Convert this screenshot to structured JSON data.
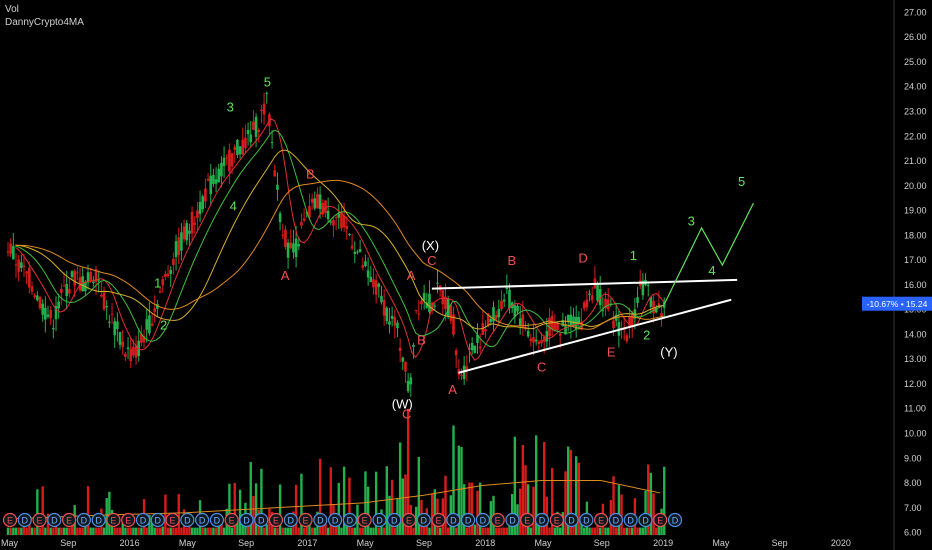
{
  "header": {
    "line1": "Vol",
    "line2": "DannyCrypto4MA"
  },
  "price_badge": {
    "text": "-10.67% • 15.24",
    "color": "#2962ff"
  },
  "colors": {
    "bull": "#22b14c",
    "bear": "#d81b1b",
    "ma_red": "#e03030",
    "ma_green": "#3cbf3c",
    "ma_orange": "#e08a1e",
    "ma_yellow": "#d6b02a",
    "ma_purple": "#b23bd6",
    "wave_green": "#5ee35e",
    "wave_red": "#f05050",
    "wave_white": "#ffffff",
    "trendline": "#ffffff"
  },
  "chart_data": {
    "type": "candlestick",
    "y_axis": {
      "min": 5.7,
      "max": 27.3,
      "ticks": [
        "27.00",
        "26.00",
        "25.00",
        "24.00",
        "23.00",
        "22.00",
        "21.00",
        "20.00",
        "19.00",
        "18.00",
        "17.00",
        "16.00",
        "15.00",
        "14.00",
        "13.00",
        "12.00",
        "11.00",
        "10.00",
        "9.00",
        "8.00",
        "7.00",
        "6.00"
      ]
    },
    "x_axis": {
      "range": [
        0,
        49.5
      ],
      "ticks": [
        {
          "t": 0.0,
          "label": "May"
        },
        {
          "t": 4.0,
          "label": "Sep"
        },
        {
          "t": 8.0,
          "label": "2016"
        },
        {
          "t": 12.0,
          "label": "May"
        },
        {
          "t": 16.0,
          "label": "Sep"
        },
        {
          "t": 20.0,
          "label": "2017"
        },
        {
          "t": 24.0,
          "label": "May"
        },
        {
          "t": 28.0,
          "label": "Sep"
        },
        {
          "t": 32.0,
          "label": "2018"
        },
        {
          "t": 36.0,
          "label": "May"
        },
        {
          "t": 40.0,
          "label": "Sep"
        },
        {
          "t": 44.0,
          "label": "2019"
        },
        {
          "t": 48.0,
          "label": "May"
        },
        {
          "t": 52.0,
          "label": "Sep"
        },
        {
          "t": 56.0,
          "label": "2020"
        }
      ]
    },
    "price_path": [
      [
        0.0,
        17.6
      ],
      [
        0.8,
        16.7
      ],
      [
        1.5,
        16.2
      ],
      [
        2.2,
        15.3
      ],
      [
        3.0,
        14.5
      ],
      [
        3.8,
        15.8
      ],
      [
        4.5,
        16.3
      ],
      [
        5.2,
        16.0
      ],
      [
        6.0,
        16.6
      ],
      [
        6.6,
        15.1
      ],
      [
        7.3,
        14.2
      ],
      [
        8.0,
        13.3
      ],
      [
        8.6,
        13.2
      ],
      [
        9.5,
        14.4
      ],
      [
        10.2,
        15.6
      ],
      [
        11.0,
        16.9
      ],
      [
        11.8,
        17.9
      ],
      [
        12.5,
        18.6
      ],
      [
        13.3,
        19.7
      ],
      [
        14.0,
        20.3
      ],
      [
        14.8,
        20.9
      ],
      [
        15.5,
        21.5
      ],
      [
        16.4,
        22.0
      ],
      [
        17.0,
        22.7
      ],
      [
        17.5,
        23.4
      ],
      [
        17.9,
        21.3
      ],
      [
        18.3,
        19.1
      ],
      [
        18.8,
        17.6
      ],
      [
        19.3,
        17.3
      ],
      [
        19.8,
        18.2
      ],
      [
        20.4,
        19.0
      ],
      [
        21.0,
        19.4
      ],
      [
        21.7,
        18.9
      ],
      [
        22.4,
        18.6
      ],
      [
        23.2,
        17.9
      ],
      [
        23.8,
        17.0
      ],
      [
        24.4,
        16.2
      ],
      [
        25.0,
        15.7
      ],
      [
        25.6,
        14.9
      ],
      [
        26.2,
        14.2
      ],
      [
        26.6,
        13.4
      ],
      [
        27.1,
        11.5
      ],
      [
        27.5,
        15.0
      ],
      [
        28.0,
        15.6
      ],
      [
        28.6,
        15.2
      ],
      [
        29.0,
        15.7
      ],
      [
        29.5,
        15.4
      ],
      [
        30.0,
        14.8
      ],
      [
        30.4,
        12.4
      ],
      [
        30.8,
        12.6
      ],
      [
        31.2,
        13.4
      ],
      [
        31.8,
        13.8
      ],
      [
        32.4,
        14.5
      ],
      [
        33.0,
        14.9
      ],
      [
        33.6,
        15.6
      ],
      [
        34.0,
        15.2
      ],
      [
        34.7,
        14.6
      ],
      [
        35.2,
        14.0
      ],
      [
        35.8,
        13.6
      ],
      [
        36.3,
        14.0
      ],
      [
        36.8,
        14.5
      ],
      [
        37.4,
        14.1
      ],
      [
        38.0,
        14.7
      ],
      [
        38.6,
        14.4
      ],
      [
        39.1,
        15.5
      ],
      [
        39.6,
        16.0
      ],
      [
        40.2,
        15.3
      ],
      [
        40.7,
        14.8
      ],
      [
        41.2,
        14.3
      ],
      [
        41.7,
        14.1
      ],
      [
        42.2,
        14.7
      ],
      [
        42.6,
        16.1
      ],
      [
        43.0,
        15.8
      ],
      [
        43.5,
        15.3
      ],
      [
        44.0,
        14.9
      ],
      [
        44.3,
        15.24
      ]
    ],
    "volume_path": [
      [
        0,
        7.0
      ],
      [
        3,
        7.4
      ],
      [
        6,
        7.3
      ],
      [
        9,
        7.0
      ],
      [
        12,
        7.8
      ],
      [
        15,
        7.6
      ],
      [
        17,
        8.4
      ],
      [
        18,
        7.2
      ],
      [
        21,
        8.6
      ],
      [
        23,
        8.3
      ],
      [
        25,
        7.8
      ],
      [
        27,
        10.8
      ],
      [
        28,
        8.4
      ],
      [
        30,
        9.6
      ],
      [
        32,
        8.6
      ],
      [
        34,
        9.4
      ],
      [
        36,
        10.3
      ],
      [
        37,
        8.6
      ],
      [
        38,
        8.8
      ],
      [
        40,
        8.0
      ],
      [
        42,
        8.4
      ],
      [
        44,
        8.0
      ]
    ],
    "volume_ma_path": [
      [
        0,
        6.55
      ],
      [
        6,
        6.7
      ],
      [
        12,
        6.8
      ],
      [
        18,
        7.0
      ],
      [
        24,
        7.2
      ],
      [
        28,
        7.5
      ],
      [
        32,
        7.9
      ],
      [
        36,
        8.1
      ],
      [
        40,
        8.1
      ],
      [
        44,
        7.6
      ]
    ],
    "moving_averages": [
      {
        "color": "ma_red",
        "period": 2
      },
      {
        "color": "ma_green",
        "period": 4
      },
      {
        "color": "ma_yellow",
        "period": 8
      },
      {
        "color": "ma_orange",
        "period": 14
      }
    ],
    "trendlines": [
      {
        "from": [
          28.6,
          15.85
        ],
        "to": [
          49.2,
          16.2
        ]
      },
      {
        "from": [
          30.4,
          12.45
        ],
        "to": [
          48.8,
          15.4
        ]
      }
    ],
    "projection": [
      [
        44.3,
        15.24
      ],
      [
        46.8,
        18.3
      ],
      [
        48.2,
        16.8
      ],
      [
        50.3,
        19.3
      ]
    ],
    "wave_labels": [
      {
        "text": "5",
        "t": 17.5,
        "v": 24.0,
        "color": "wave_green"
      },
      {
        "text": "3",
        "t": 15.0,
        "v": 23.0,
        "color": "wave_green"
      },
      {
        "text": "4",
        "t": 15.2,
        "v": 19.0,
        "color": "wave_green"
      },
      {
        "text": "1",
        "t": 10.1,
        "v": 15.9,
        "color": "wave_green"
      },
      {
        "text": "2",
        "t": 10.5,
        "v": 14.2,
        "color": "wave_green"
      },
      {
        "text": "B",
        "t": 20.4,
        "v": 20.3,
        "color": "wave_red"
      },
      {
        "text": "A",
        "t": 18.7,
        "v": 16.2,
        "color": "wave_red"
      },
      {
        "text": "(X)",
        "t": 28.5,
        "v": 17.4,
        "color": "wave_white"
      },
      {
        "text": "C",
        "t": 28.6,
        "v": 16.8,
        "color": "wave_red"
      },
      {
        "text": "A",
        "t": 27.2,
        "v": 16.2,
        "color": "wave_red"
      },
      {
        "text": "B",
        "t": 27.9,
        "v": 13.6,
        "color": "wave_red"
      },
      {
        "text": "(W)",
        "t": 26.6,
        "v": 11.0,
        "color": "wave_white"
      },
      {
        "text": "C",
        "t": 26.9,
        "v": 10.6,
        "color": "wave_red"
      },
      {
        "text": "A",
        "t": 30.0,
        "v": 11.6,
        "color": "wave_red"
      },
      {
        "text": "B",
        "t": 34.0,
        "v": 16.8,
        "color": "wave_red"
      },
      {
        "text": "C",
        "t": 36.0,
        "v": 12.5,
        "color": "wave_red"
      },
      {
        "text": "D",
        "t": 38.8,
        "v": 16.9,
        "color": "wave_red"
      },
      {
        "text": "E",
        "t": 40.7,
        "v": 13.1,
        "color": "wave_red"
      },
      {
        "text": "1",
        "t": 42.2,
        "v": 17.0,
        "color": "wave_green"
      },
      {
        "text": "2",
        "t": 43.1,
        "v": 13.8,
        "color": "wave_green"
      },
      {
        "text": "(Y)",
        "t": 44.6,
        "v": 13.1,
        "color": "wave_white"
      },
      {
        "text": "3",
        "t": 46.1,
        "v": 18.4,
        "color": "wave_green"
      },
      {
        "text": "4",
        "t": 47.5,
        "v": 16.4,
        "color": "wave_green"
      },
      {
        "text": "5",
        "t": 49.5,
        "v": 20.0,
        "color": "wave_green"
      }
    ],
    "event_markers": [
      "E",
      "D",
      "E",
      "D",
      "E",
      "D",
      "D",
      "E",
      "E",
      "D",
      "D",
      "E",
      "D",
      "D",
      "D",
      "E",
      "D",
      "D",
      "E",
      "D",
      "E",
      "D",
      "D",
      "D",
      "E",
      "D",
      "D",
      "E",
      "D",
      "E",
      "D",
      "D",
      "D",
      "E",
      "D",
      "E",
      "D",
      "E",
      "D",
      "D",
      "E",
      "D",
      "D",
      "D",
      "E",
      "D"
    ]
  }
}
